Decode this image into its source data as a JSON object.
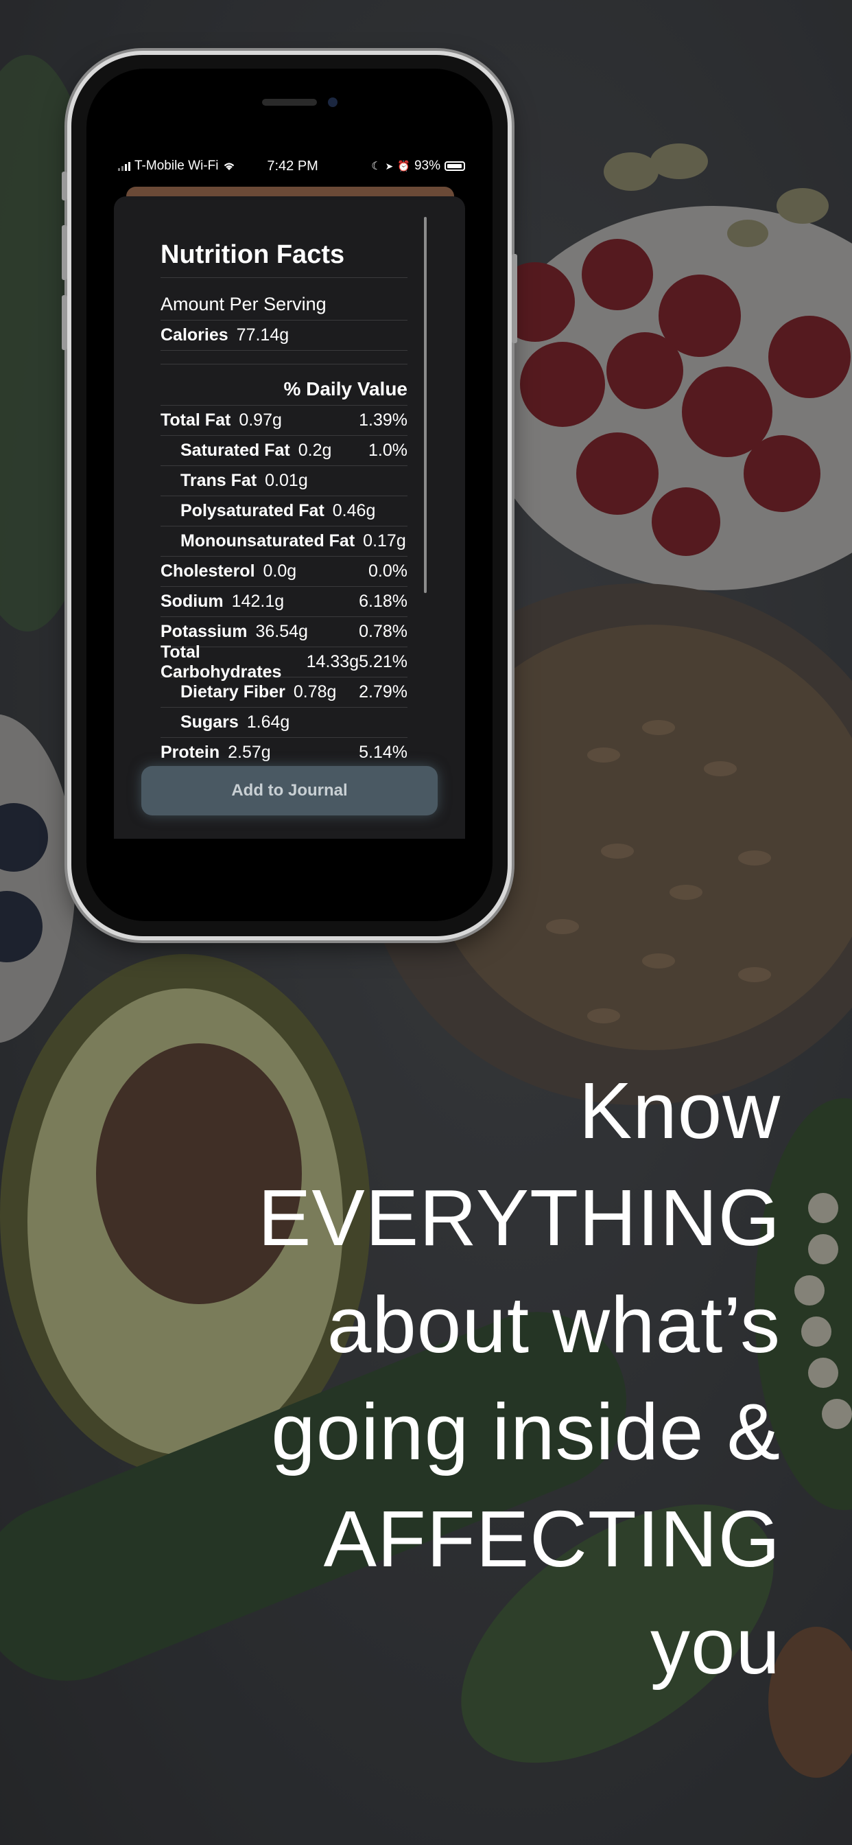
{
  "status_bar": {
    "carrier": "T-Mobile Wi-Fi",
    "time": "7:42 PM",
    "battery": "93%",
    "icons": [
      "signal-icon",
      "wifi-icon",
      "moon-icon",
      "location-icon",
      "alarm-icon",
      "battery-icon"
    ]
  },
  "nutrition": {
    "title": "Nutrition Facts",
    "amount_per_serving": "Amount Per Serving",
    "calories_label": "Calories",
    "calories_value": "77.14g",
    "daily_value_header": "% Daily Value",
    "rows": [
      {
        "label": "Total Fat",
        "value": "0.97g",
        "pct": "1.39%",
        "indent": false
      },
      {
        "label": "Saturated Fat",
        "value": "0.2g",
        "pct": "1.0%",
        "indent": true
      },
      {
        "label": "Trans Fat",
        "value": "0.01g",
        "pct": "",
        "indent": true
      },
      {
        "label": "Polysaturated Fat",
        "value": "0.46g",
        "pct": "",
        "indent": true
      },
      {
        "label": "Monounsaturated Fat",
        "value": "0.17g",
        "pct": "",
        "indent": true
      },
      {
        "label": "Cholesterol",
        "value": "0.0g",
        "pct": "0.0%",
        "indent": false
      },
      {
        "label": "Sodium",
        "value": "142.1g",
        "pct": "6.18%",
        "indent": false
      },
      {
        "label": "Potassium",
        "value": "36.54g",
        "pct": "0.78%",
        "indent": false
      },
      {
        "label": "Total Carbohydrates",
        "value": "14.33g",
        "pct": "5.21%",
        "indent": false
      },
      {
        "label": "Dietary Fiber",
        "value": "0.78g",
        "pct": "2.79%",
        "indent": true
      },
      {
        "label": "Sugars",
        "value": "1.64g",
        "pct": "",
        "indent": true
      },
      {
        "label": "Protein",
        "value": "2.57g",
        "pct": "5.14%",
        "indent": false
      }
    ]
  },
  "actions": {
    "add_to_journal": "Add to Journal"
  },
  "tagline": {
    "lines": [
      "Know",
      "EVERYTHING",
      "about what’s",
      "going inside &",
      "AFFECTING",
      "you"
    ]
  },
  "colors": {
    "card_bg": "#1c1c1e",
    "button_bg": "#4a5963",
    "header_strip": "#6b4a37"
  }
}
